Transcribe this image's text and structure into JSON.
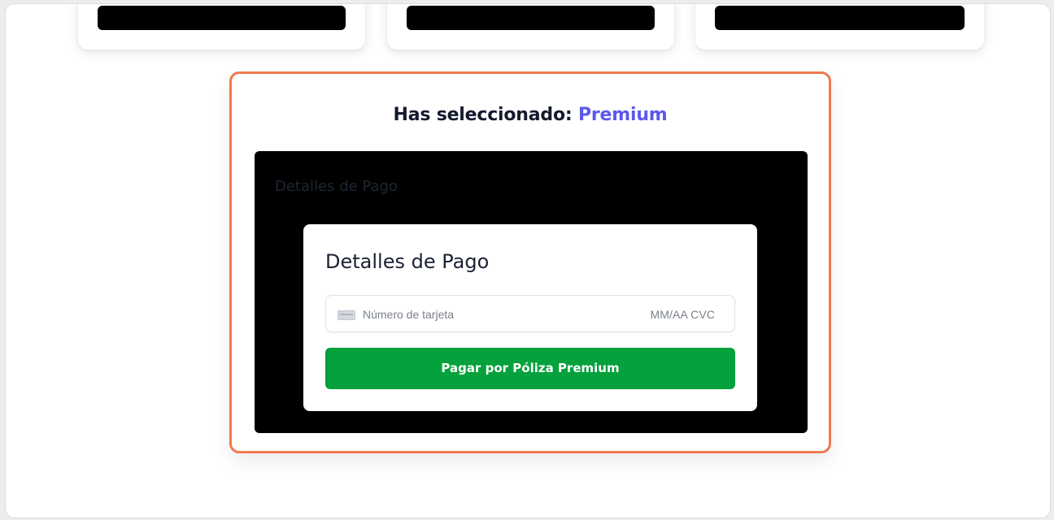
{
  "summary": {
    "title_prefix": "Has seleccionado: ",
    "plan_name": "Premium"
  },
  "payment_panel": {
    "heading": "Detalles de Pago"
  },
  "payment_card": {
    "title": "Detalles de Pago",
    "card_number_placeholder": "Número de tarjeta",
    "expiry_cvc_placeholder": "MM/AA CVC",
    "submit_label": "Pagar por Póliza Premium"
  },
  "icons": {
    "card": "credit-card-icon"
  },
  "colors": {
    "accent_border": "#ee7a4e",
    "plan_highlight": "#5b57f0",
    "pay_button": "#05a13c"
  }
}
